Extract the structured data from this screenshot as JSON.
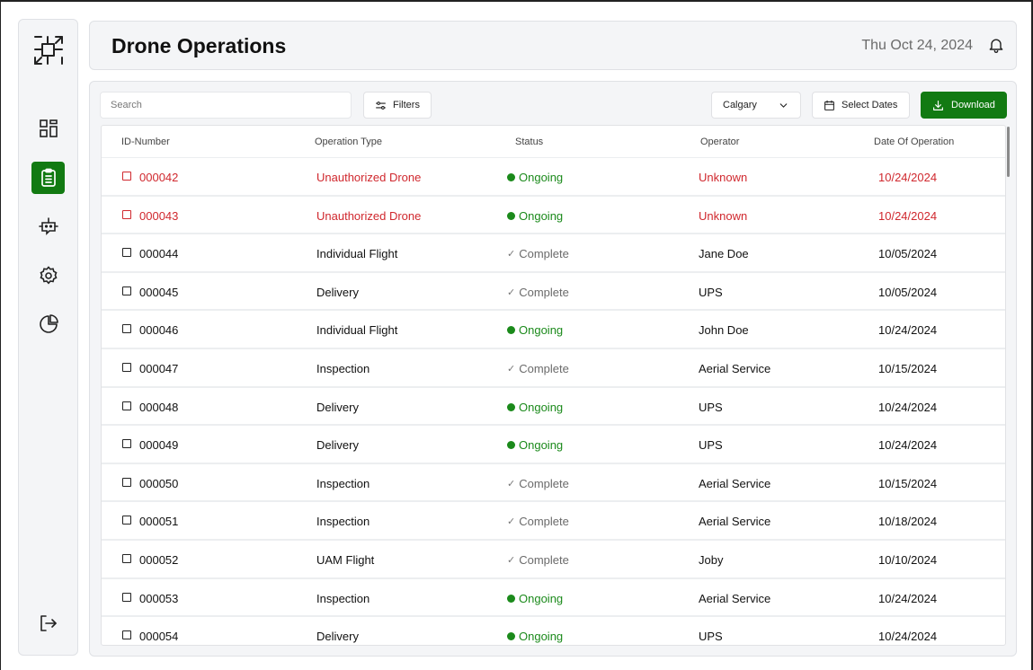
{
  "sidebar": {
    "logo_icon": "drone-frame-icon",
    "items": [
      {
        "name": "dashboard",
        "icon": "dashboard-icon",
        "active": false
      },
      {
        "name": "operations",
        "icon": "clipboard-icon",
        "active": true
      },
      {
        "name": "drones",
        "icon": "drone-icon",
        "active": false
      },
      {
        "name": "settings",
        "icon": "gear-icon",
        "active": false
      },
      {
        "name": "analytics",
        "icon": "pie-chart-icon",
        "active": false
      }
    ],
    "logout_icon": "logout-icon"
  },
  "header": {
    "title": "Drone Operations",
    "date": "Thu Oct 24, 2024",
    "bell_icon": "bell-icon"
  },
  "toolbar": {
    "search_placeholder": "Search",
    "filters_label": "Filters",
    "city_selected": "Calgary",
    "select_dates_label": "Select Dates",
    "download_label": "Download"
  },
  "colors": {
    "accent": "#127a12",
    "alert": "#d0282e",
    "ongoing": "#1b8a1b",
    "complete": "#6b6b6b"
  },
  "table": {
    "columns": [
      "ID-Number",
      "Operation Type",
      "Status",
      "Operator",
      "Date Of Operation"
    ],
    "rows": [
      {
        "id": "000042",
        "type": "Unauthorized Drone",
        "status": "Ongoing",
        "operator": "Unknown",
        "date": "10/24/2024",
        "alert": true
      },
      {
        "id": "000043",
        "type": "Unauthorized Drone",
        "status": "Ongoing",
        "operator": "Unknown",
        "date": "10/24/2024",
        "alert": true
      },
      {
        "id": "000044",
        "type": "Individual Flight",
        "status": "Complete",
        "operator": "Jane Doe",
        "date": "10/05/2024",
        "alert": false
      },
      {
        "id": "000045",
        "type": "Delivery",
        "status": "Complete",
        "operator": "UPS",
        "date": "10/05/2024",
        "alert": false
      },
      {
        "id": "000046",
        "type": "Individual Flight",
        "status": "Ongoing",
        "operator": "John Doe",
        "date": "10/24/2024",
        "alert": false
      },
      {
        "id": "000047",
        "type": "Inspection",
        "status": "Complete",
        "operator": "Aerial Service",
        "date": "10/15/2024",
        "alert": false
      },
      {
        "id": "000048",
        "type": "Delivery",
        "status": "Ongoing",
        "operator": "UPS",
        "date": "10/24/2024",
        "alert": false
      },
      {
        "id": "000049",
        "type": "Delivery",
        "status": "Ongoing",
        "operator": "UPS",
        "date": "10/24/2024",
        "alert": false
      },
      {
        "id": "000050",
        "type": "Inspection",
        "status": "Complete",
        "operator": "Aerial Service",
        "date": "10/15/2024",
        "alert": false
      },
      {
        "id": "000051",
        "type": "Inspection",
        "status": "Complete",
        "operator": "Aerial Service",
        "date": "10/18/2024",
        "alert": false
      },
      {
        "id": "000052",
        "type": "UAM Flight",
        "status": "Complete",
        "operator": "Joby",
        "date": "10/10/2024",
        "alert": false
      },
      {
        "id": "000053",
        "type": "Inspection",
        "status": "Ongoing",
        "operator": "Aerial Service",
        "date": "10/24/2024",
        "alert": false
      },
      {
        "id": "000054",
        "type": "Delivery",
        "status": "Ongoing",
        "operator": "UPS",
        "date": "10/24/2024",
        "alert": false
      }
    ]
  }
}
